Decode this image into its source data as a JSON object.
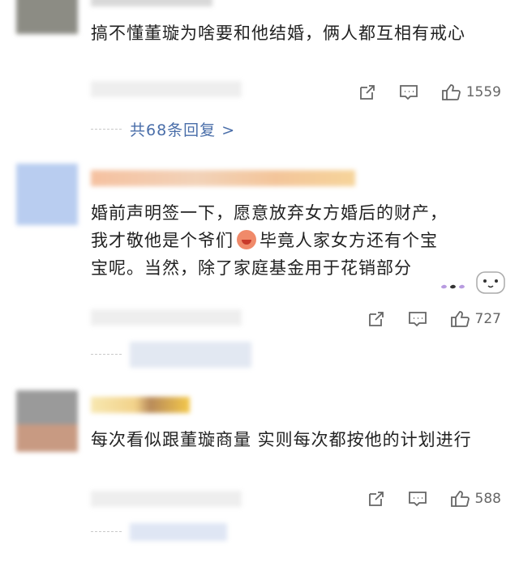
{
  "comments": [
    {
      "text": "搞不懂董璇为啥要和他结婚，俩人都互相有戒心",
      "likes": "1559",
      "reply_link": "共68条回复 >"
    },
    {
      "text_line1": "婚前声明签一下，愿意放弃女方婚后的财产，",
      "text_line2a": "我才敬他是个爷们",
      "text_line2b": "毕竟人家女方还有个宝",
      "text_line3": "宝呢。当然，除了家庭基金用于花销部分",
      "likes": "727"
    },
    {
      "text": "每次看似跟董璇商量 实则每次都按他的计划进行",
      "likes": "588"
    }
  ],
  "icons": {
    "share": "share-icon",
    "comment": "comment-icon",
    "like": "thumbs-up-icon"
  },
  "colors": {
    "link": "#4a6ea9",
    "text": "#222222",
    "icon": "#666666"
  }
}
